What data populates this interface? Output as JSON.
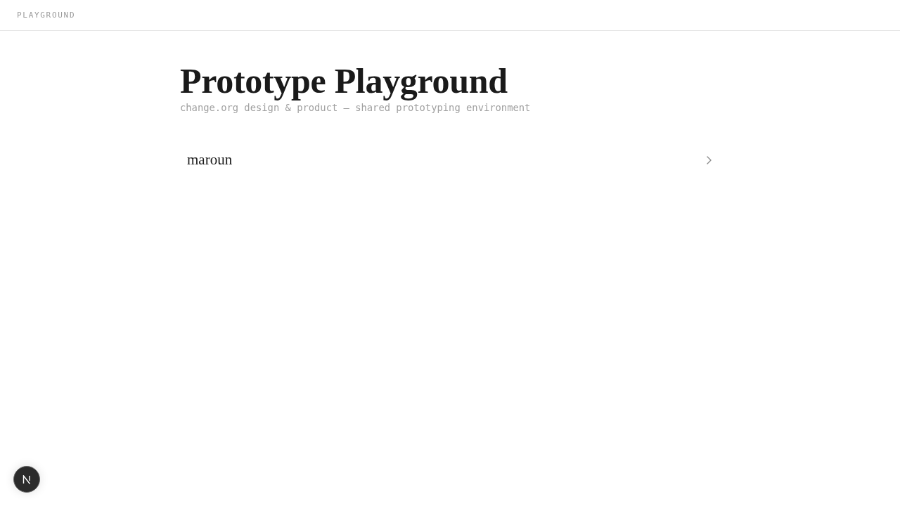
{
  "header": {
    "title": "PLAYGROUND"
  },
  "page": {
    "title": "Prototype Playground",
    "subtitle": "change.org design & product — shared prototyping environment"
  },
  "items": [
    {
      "label": "maroun"
    }
  ]
}
